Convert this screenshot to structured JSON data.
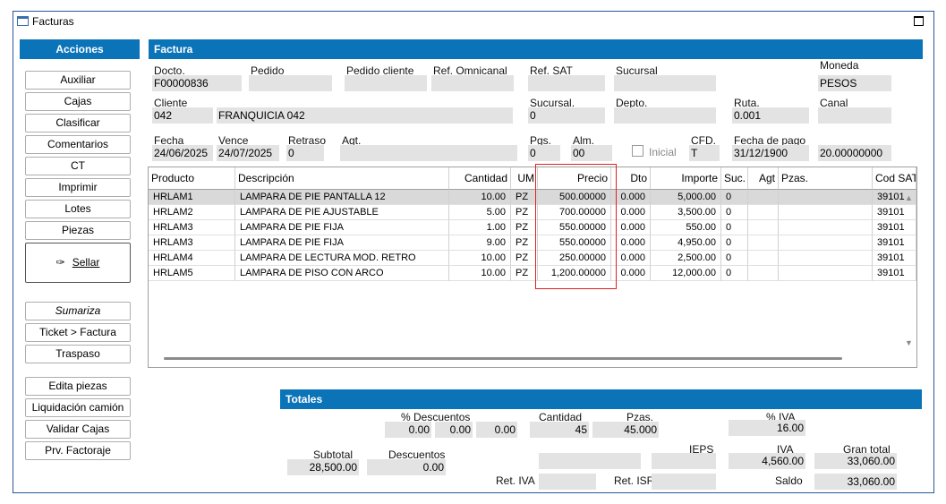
{
  "window": {
    "title": "Facturas"
  },
  "sidebar": {
    "header": "Acciones",
    "buttons": [
      "Auxiliar",
      "Cajas",
      "Clasificar",
      "Comentarios",
      "CT",
      "Imprimir",
      "Lotes",
      "Piezas"
    ],
    "sellar": "Sellar",
    "buttons2": [
      "Sumariza",
      "Ticket > Factura",
      "Traspaso"
    ],
    "buttons3": [
      "Edita piezas",
      "Liquidación camión",
      "Validar Cajas",
      "Prv. Factoraje"
    ]
  },
  "factura": {
    "header": "Factura",
    "docto_label": "Docto.",
    "docto": "F00000836",
    "pedido_label": "Pedido",
    "pedido": "",
    "pedido_cliente_label": "Pedido cliente",
    "pedido_cliente": "",
    "ref_omnicanal_label": "Ref. Omnicanal",
    "ref_omnicanal": "",
    "ref_sat_label": "Ref. SAT",
    "ref_sat": "",
    "sucursal_label": "Sucursal",
    "sucursal": "",
    "moneda_label": "Moneda",
    "moneda": "PESOS",
    "cliente_label": "Cliente",
    "cliente_id": "042",
    "cliente_nombre": "FRANQUICIA 042",
    "sucursal2_label": "Sucursal.",
    "sucursal2": "0",
    "depto_label": "Depto.",
    "depto": "",
    "ruta_label": "Ruta.",
    "ruta": "0.001",
    "canal_label": "Canal",
    "canal": "",
    "fecha_label": "Fecha",
    "fecha": "24/06/2025",
    "vence_label": "Vence",
    "vence": "24/07/2025",
    "retraso_label": "Retraso",
    "retraso": "0",
    "agt_label": "Agt.",
    "agt": "",
    "pgs_label": "Pgs.",
    "pgs": "0",
    "alm_label": "Alm.",
    "alm": "00",
    "inicial_label": "Inicial",
    "cfd_label": "CFD.",
    "cfd": "T",
    "fecha_pago_label": "Fecha de pago",
    "fecha_pago": "31/12/1900",
    "tipo_cambio": "20.00000000"
  },
  "grid": {
    "columns": [
      "Producto",
      "Descripción",
      "Cantidad",
      "UM",
      "Precio",
      "Dto",
      "Importe",
      "Suc.",
      "Agt",
      "Pzas.",
      "Cod SAT"
    ],
    "rows": [
      [
        "HRLAM1",
        "LAMPARA DE PIE PANTALLA 12",
        "10.00",
        "PZ",
        "500.00000",
        "0.000",
        "5,000.00",
        "0",
        "",
        "",
        "39101"
      ],
      [
        "HRLAM2",
        "LAMPARA DE PIE AJUSTABLE",
        "5.00",
        "PZ",
        "700.00000",
        "0.000",
        "3,500.00",
        "0",
        "",
        "",
        "39101"
      ],
      [
        "HRLAM3",
        "LAMPARA DE PIE FIJA",
        "1.00",
        "PZ",
        "550.00000",
        "0.000",
        "550.00",
        "0",
        "",
        "",
        "39101"
      ],
      [
        "HRLAM3",
        "LAMPARA DE PIE FIJA",
        "9.00",
        "PZ",
        "550.00000",
        "0.000",
        "4,950.00",
        "0",
        "",
        "",
        "39101"
      ],
      [
        "HRLAM4",
        "LAMPARA DE LECTURA MOD. RETRO",
        "10.00",
        "PZ",
        "250.00000",
        "0.000",
        "2,500.00",
        "0",
        "",
        "",
        "39101"
      ],
      [
        "HRLAM5",
        "LAMPARA DE PISO CON ARCO",
        "10.00",
        "PZ",
        "1,200.00000",
        "0.000",
        "12,000.00",
        "0",
        "",
        "",
        "39101"
      ]
    ]
  },
  "totales": {
    "header": "Totales",
    "pct_desc_label": "% Descuentos",
    "pct_desc": [
      "0.00",
      "0.00",
      "0.00"
    ],
    "cantidad_label": "Cantidad",
    "cantidad": "45",
    "pzas_label": "Pzas.",
    "pzas": "45.000",
    "pct_iva_label": "% IVA",
    "pct_iva": "16.00",
    "subtotal_label": "Subtotal",
    "subtotal": "28,500.00",
    "descuentos_label": "Descuentos",
    "descuentos": "0.00",
    "ieps_label": "IEPS",
    "ieps": "",
    "iva_label": "IVA",
    "iva": "4,560.00",
    "gran_total_label": "Gran total",
    "gran_total": "33,060.00",
    "ret_iva_label": "Ret. IVA",
    "ret_iva": "",
    "ret_isr_label": "Ret. ISR",
    "ret_isr": "",
    "saldo_label": "Saldo",
    "saldo": "33,060.00"
  }
}
